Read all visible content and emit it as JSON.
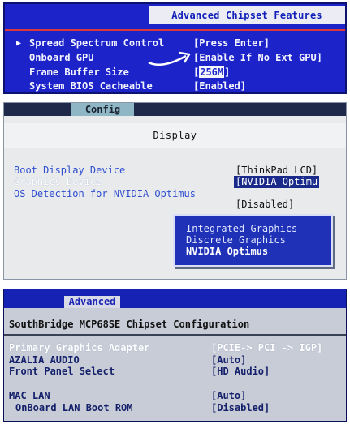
{
  "panel1": {
    "title": "Advanced Chipset Features",
    "items": [
      {
        "label": "Spread Spectrum Control",
        "value": "[Press Enter]",
        "selected": true
      },
      {
        "label": "Onboard GPU",
        "value": "[Enable If No Ext GPU]"
      },
      {
        "label": "Frame Buffer Size",
        "value_prefix": "[",
        "value_highlight": "256M",
        "value_suffix": "]"
      },
      {
        "label": "System BIOS Cacheable",
        "value": "[Enabled]"
      }
    ]
  },
  "panel2": {
    "tab": "Config",
    "heading": "Display",
    "items": [
      {
        "label": "Boot Display Device",
        "value": "[ThinkPad LCD]"
      },
      {
        "label": "Graphics Device",
        "value": "[NVIDIA Optimu"
      },
      {
        "label": "OS Detection for NVIDIA Optimus",
        "value": "[Disabled]"
      }
    ],
    "popup_options": [
      "Integrated Graphics",
      "Discrete Graphics",
      "NVIDIA Optimus"
    ]
  },
  "panel3": {
    "tab": "Advanced",
    "heading": "SouthBridge MCP68SE Chipset Configuration",
    "items": [
      {
        "label": "Primary Graphics Adapter",
        "value": "[PCIE-> PCI -> IGP]"
      },
      {
        "label": "AZALIA AUDIO",
        "value": "[Auto]"
      },
      {
        "label": "Front Panel Select",
        "value": "[HD Audio]"
      },
      {
        "label": "MAC LAN",
        "value": "[Auto]"
      },
      {
        "label": "OnBoard LAN Boot ROM",
        "value": "[Disabled]"
      }
    ]
  }
}
